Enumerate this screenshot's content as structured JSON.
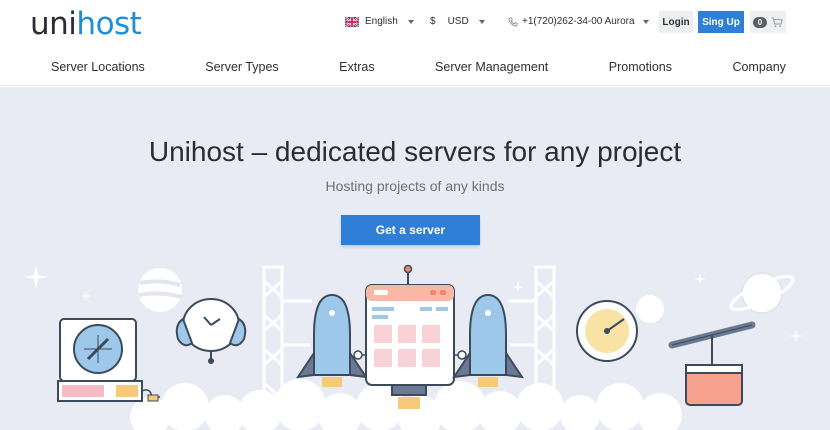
{
  "header": {
    "logo": {
      "part1": "uni",
      "part2": "host"
    },
    "language": {
      "label": "English",
      "icon": "uk-flag-icon"
    },
    "currency": {
      "symbol": "$",
      "label": "USD"
    },
    "phone": {
      "label": "+1(720)262-34-00 Aurora",
      "icon": "phone-icon"
    },
    "login_label": "Login",
    "signup_label": "Sing Up",
    "cart": {
      "count": "0",
      "icon": "cart-icon"
    }
  },
  "nav": {
    "items": [
      {
        "label": "Server Locations"
      },
      {
        "label": "Server Types"
      },
      {
        "label": "Extras"
      },
      {
        "label": "Server Management"
      },
      {
        "label": "Promotions"
      },
      {
        "label": "Company"
      }
    ]
  },
  "hero": {
    "title": "Unihost – dedicated servers for any project",
    "subtitle": "Hosting projects of any kinds",
    "cta_label": "Get a server"
  },
  "colors": {
    "accent": "#2f7fd6",
    "logo_blue": "#1d8fd8",
    "hero_bg": "#e8ebf4"
  }
}
